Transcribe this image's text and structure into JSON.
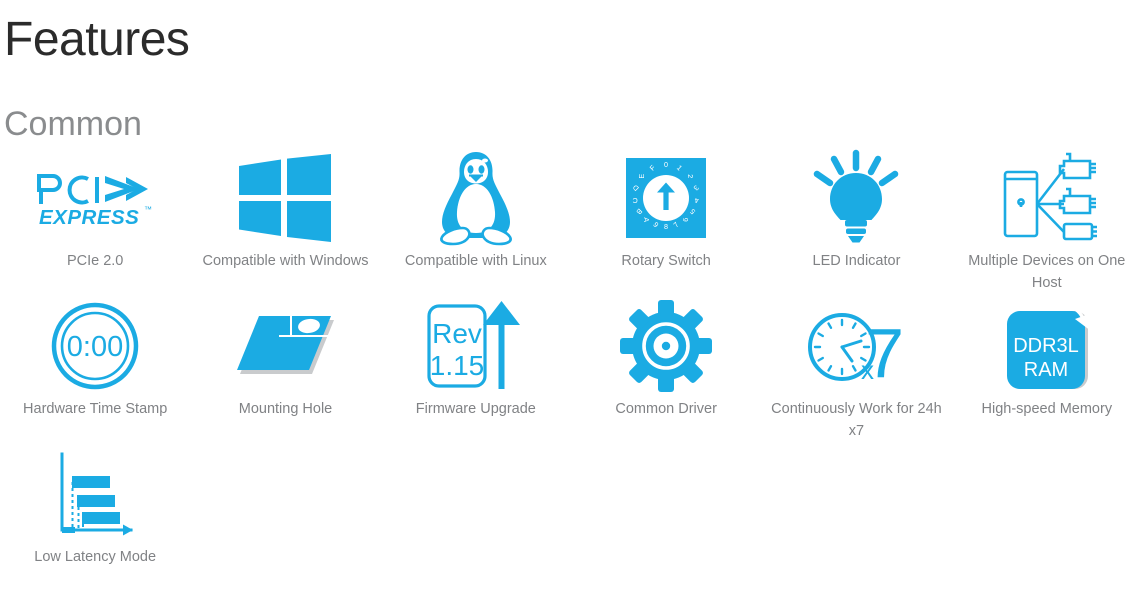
{
  "page": {
    "title": "Features",
    "section": "Common"
  },
  "colors": {
    "accent": "#1BABE3",
    "accent_dark": "#0F9BD8",
    "label_text": "#808285",
    "title_text": "#2b2b2b",
    "section_text": "#8a8c8e",
    "background": "#ffffff"
  },
  "features": [
    {
      "id": "pcie-20",
      "label": "PCIe 2.0",
      "icon": "pci-express-logo-icon",
      "icon_text": {
        "primary": "PCI",
        "secondary": "EXPRESS",
        "trademark": "™"
      }
    },
    {
      "id": "compatible-windows",
      "label": "Compatible with Windows",
      "icon": "windows-logo-icon"
    },
    {
      "id": "compatible-linux",
      "label": "Compatible with Linux",
      "icon": "linux-tux-penguin-icon"
    },
    {
      "id": "rotary-switch",
      "label": "Rotary Switch",
      "icon": "rotary-switch-icon",
      "icon_text": {
        "dial_positions": [
          "0",
          "1",
          "2",
          "3",
          "4",
          "5",
          "6",
          "7",
          "8",
          "9",
          "A",
          "B",
          "C",
          "D",
          "E",
          "F"
        ]
      }
    },
    {
      "id": "led-indicator",
      "label": "LED Indicator",
      "icon": "lightbulb-icon"
    },
    {
      "id": "multiple-devices",
      "label": "Multiple Devices on One Host",
      "icon": "host-multiple-devices-icon"
    },
    {
      "id": "hardware-time-stamp",
      "label": "Hardware Time Stamp",
      "icon": "stopwatch-icon",
      "icon_text": {
        "time": "0:00"
      }
    },
    {
      "id": "mounting-hole",
      "label": "Mounting Hole",
      "icon": "mounting-plate-hole-icon"
    },
    {
      "id": "firmware-upgrade",
      "label": "Firmware Upgrade",
      "icon": "firmware-upgrade-icon",
      "icon_text": {
        "rev_label": "Rev",
        "rev_number": "1.15"
      }
    },
    {
      "id": "common-driver",
      "label": "Common Driver",
      "icon": "gear-icon"
    },
    {
      "id": "continuous-work",
      "label": "Continuously Work for 24h x7",
      "icon": "clock-x7-icon",
      "icon_text": {
        "multiplier_small": "x",
        "multiplier_big": "7"
      }
    },
    {
      "id": "high-speed-memory",
      "label": "High-speed Memory",
      "icon": "ddr3l-ram-icon",
      "icon_text": {
        "line1": "DDR3L",
        "line2": "RAM"
      }
    },
    {
      "id": "low-latency-mode",
      "label": "Low Latency Mode",
      "icon": "low-latency-chart-icon"
    }
  ]
}
